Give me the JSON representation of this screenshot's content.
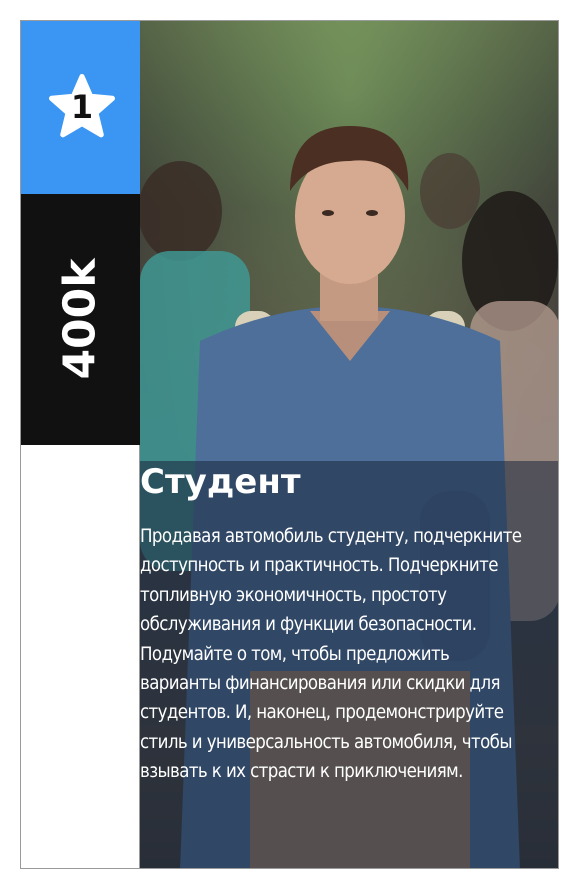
{
  "card": {
    "rank": "1",
    "price": "400k",
    "title": "Студент",
    "description": "Продавая автомобиль студенту, подчеркните доступность и практичность. Подчеркните топливную экономичность, простоту обслуживания и функции безопасности. Подумайте о том, чтобы предложить варианты финансирования или скидки для студентов. И, наконец, продемонстрируйте стиль и универсальность автомобиля, чтобы взывать к их страсти к приключениям."
  },
  "colors": {
    "rank_bg": "#3a96f2",
    "price_bg": "#111111",
    "text": "#ffffff"
  },
  "icons": {
    "rank": "star-icon"
  }
}
